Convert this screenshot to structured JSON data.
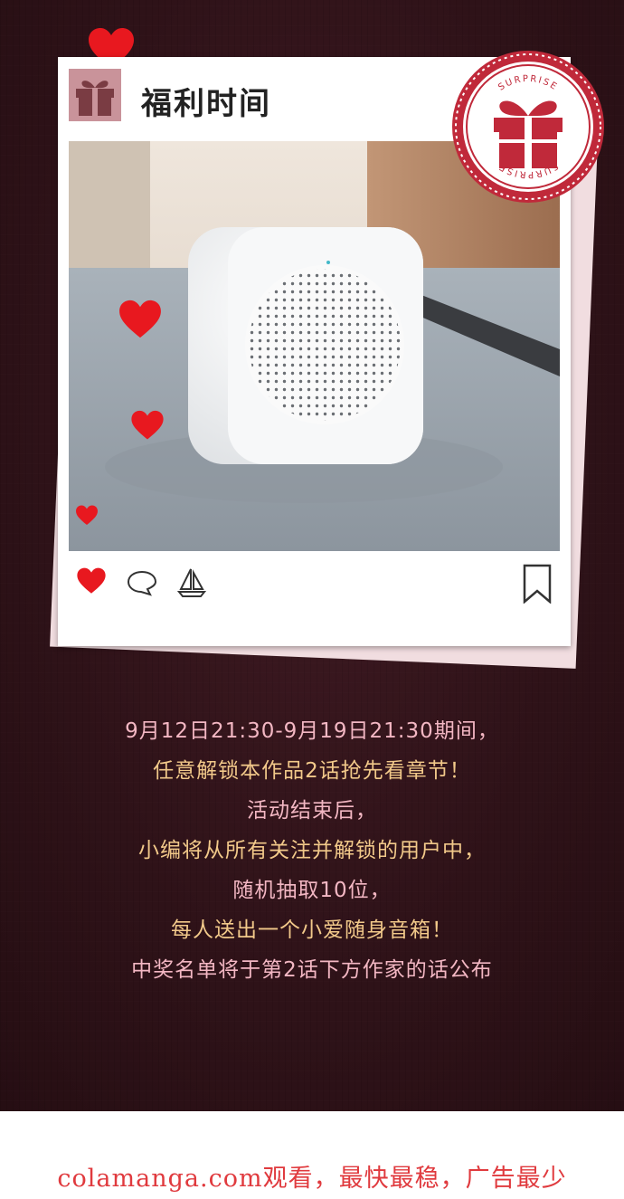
{
  "card": {
    "title": "福利时间",
    "stamp_top_text": "SURPRISE",
    "stamp_bottom_text": "SURPRISE"
  },
  "icons": {
    "gift": "gift-icon",
    "heart": "heart-icon",
    "comment": "comment-icon",
    "share": "sailboat-icon",
    "bookmark": "bookmark-icon"
  },
  "announcement": {
    "lines": [
      {
        "text": "9月12日21:30-9月19日21:30期间，",
        "color": "#f3b7c3"
      },
      {
        "text": "任意解锁本作品2话抢先看章节！",
        "color": "#f2c98a"
      },
      {
        "text": "活动结束后，",
        "color": "#f3b7c3"
      },
      {
        "text": "小编将从所有关注并解锁的用户中，",
        "color": "#f2c98a"
      },
      {
        "text": "随机抽取10位，",
        "color": "#f3b7c3"
      },
      {
        "text": "每人送出一个小爱随身音箱！",
        "color": "#f2c98a"
      },
      {
        "text": "中奖名单将于第2话下方作家的话公布",
        "color": "#f3b7c3"
      }
    ]
  },
  "footer": {
    "text": "colamanga.com观看，最快最稳，广告最少"
  },
  "colors": {
    "background": "#2e1218",
    "heart": "#e8181f",
    "footer_text": "#e03a3e",
    "stamp": "#c0293a"
  }
}
